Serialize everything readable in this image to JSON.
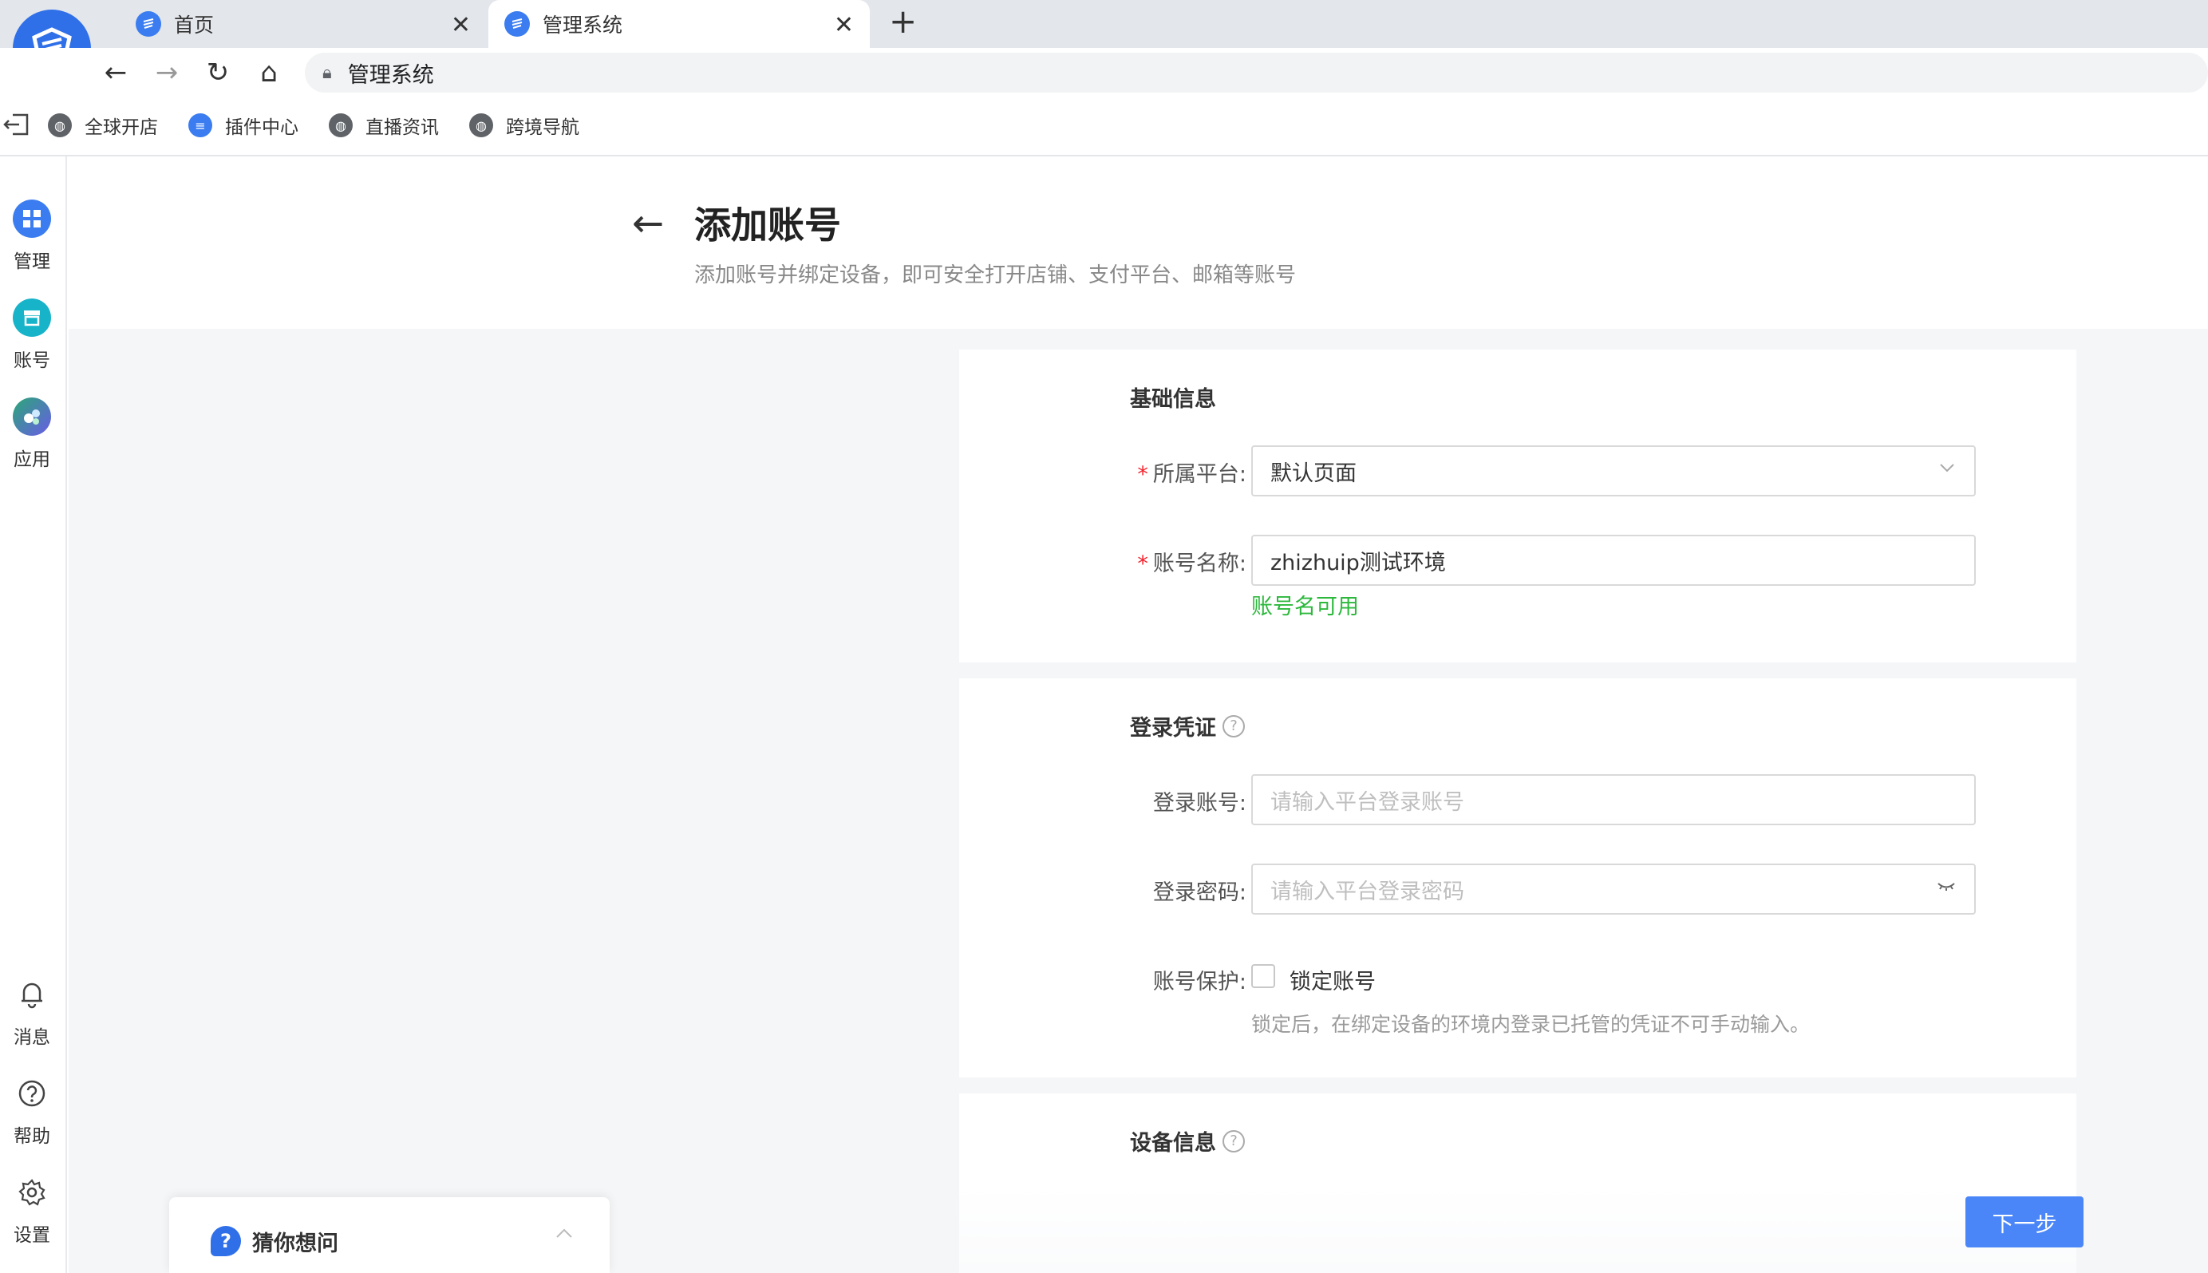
{
  "browser": {
    "tabs": [
      {
        "label": "首页",
        "active": false
      },
      {
        "label": "管理系统",
        "active": true
      }
    ],
    "new_tab": "+",
    "tab_close": "✕",
    "address": "管理系统",
    "bookmarks": [
      {
        "label": "全球开店",
        "icon": "globe-icon"
      },
      {
        "label": "插件中心",
        "icon": "app-logo-icon"
      },
      {
        "label": "直播资讯",
        "icon": "globe-icon"
      },
      {
        "label": "跨境导航",
        "icon": "globe-icon"
      }
    ]
  },
  "sidebar": {
    "top": [
      {
        "label": "管理",
        "icon": "grid-icon",
        "color": "#3b7df0"
      },
      {
        "label": "账号",
        "icon": "store-icon",
        "color": "#17b3c9"
      },
      {
        "label": "应用",
        "icon": "apps-icon",
        "color": "#2aa876"
      }
    ],
    "bottom": [
      {
        "label": "消息",
        "icon": "bell-icon"
      },
      {
        "label": "帮助",
        "icon": "help-icon"
      },
      {
        "label": "设置",
        "icon": "gear-icon"
      }
    ]
  },
  "page": {
    "title": "添加账号",
    "subtitle": "添加账号并绑定设备，即可安全打开店铺、支付平台、邮箱等账号"
  },
  "basic_info": {
    "title": "基础信息",
    "platform_label": "所属平台:",
    "platform_value": "默认页面",
    "name_label": "账号名称:",
    "name_value": "zhizhuip测试环境",
    "name_hint": "账号名可用"
  },
  "credentials": {
    "title": "登录凭证",
    "login_account_label": "登录账号:",
    "login_account_placeholder": "请输入平台登录账号",
    "login_password_label": "登录密码:",
    "login_password_placeholder": "请输入平台登录密码",
    "protect_label": "账号保护:",
    "lock_checkbox_label": "锁定账号",
    "lock_desc": "锁定后，在绑定设备的环境内登录已托管的凭证不可手动输入。"
  },
  "device_info": {
    "title": "设备信息"
  },
  "actions": {
    "next": "下一步"
  },
  "guess_panel": {
    "title": "猜你想问"
  },
  "colors": {
    "accent": "#4a86f7",
    "success": "#2db83d",
    "required": "#f5222d"
  }
}
